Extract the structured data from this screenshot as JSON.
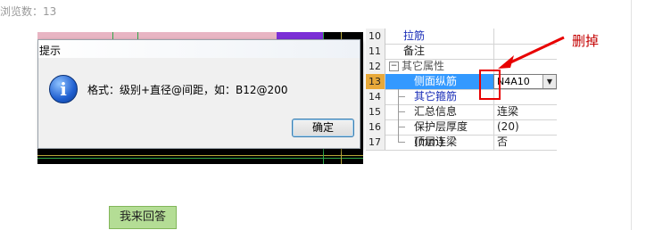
{
  "header": {
    "views_text": "浏览数：13"
  },
  "dialog": {
    "title": "提示",
    "message": "格式：级别+直径@间距，如：B12@200",
    "ok_label": "确定"
  },
  "grid": {
    "rows": [
      {
        "num": "10",
        "name": "拉筋",
        "value": ""
      },
      {
        "num": "11",
        "name": "备注",
        "value": ""
      },
      {
        "num": "12",
        "name": "其它属性",
        "value": ""
      },
      {
        "num": "13",
        "name": "侧面纵筋",
        "value": "N4A10"
      },
      {
        "num": "14",
        "name": "其它箍筋",
        "value": ""
      },
      {
        "num": "15",
        "name": "汇总信息",
        "value": "连梁"
      },
      {
        "num": "16",
        "name": "保护层厚度(mm)",
        "value": "(20)"
      },
      {
        "num": "17",
        "name": "顶层连梁",
        "value": "否"
      }
    ]
  },
  "annotation": {
    "label": "删掉",
    "color": "#e80000"
  },
  "answer_button": {
    "label": "我来回答"
  }
}
